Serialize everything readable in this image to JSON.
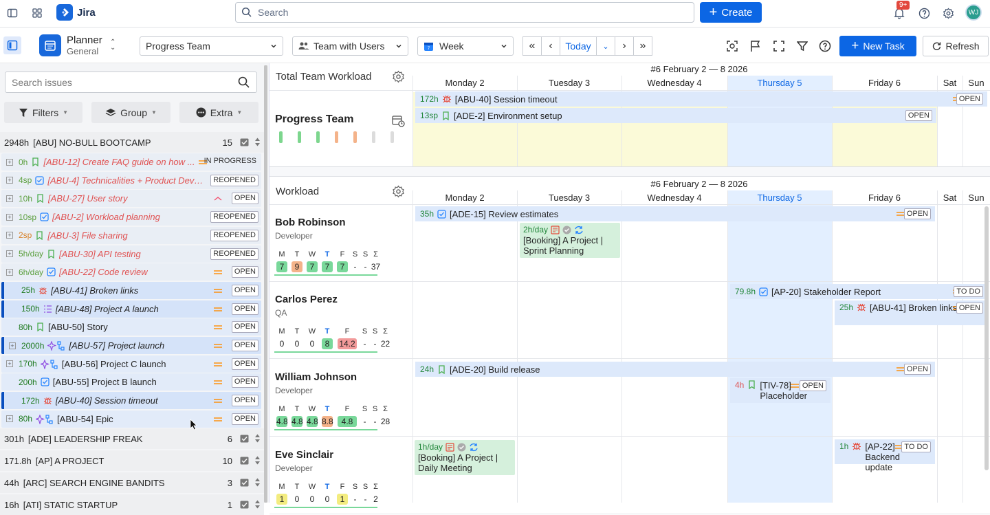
{
  "app": {
    "name": "Jira",
    "search_placeholder": "Search",
    "create_label": "Create",
    "notif_badge": "9+",
    "avatar": "WJ"
  },
  "toolbar": {
    "planner_title": "Planner",
    "planner_sub": "General",
    "team_select": "Progress Team",
    "users_select": "Team with Users",
    "period_select": "Week",
    "today": "Today",
    "new_task": "New Task",
    "refresh": "Refresh"
  },
  "left": {
    "search_placeholder": "Search issues",
    "filters": "Filters",
    "group": "Group",
    "extra": "Extra",
    "groups": [
      {
        "est": "2948h",
        "name": "[ABU] NO-BULL BOOTCAMP",
        "count": "15"
      },
      {
        "est": "301h",
        "name": "[ADE] LEADERSHIP FREAK",
        "count": "6"
      },
      {
        "est": "171.8h",
        "name": "[AP] A PROJECT",
        "count": "10"
      },
      {
        "est": "44h",
        "name": "[ARC] SEARCH ENGINE BANDITS",
        "count": "3"
      },
      {
        "est": "16h",
        "name": "[ATI] STATIC STARTUP",
        "count": "1"
      }
    ],
    "rows": [
      {
        "est": "0h",
        "title": "[ABU-12] Create FAQ guide on how ...",
        "status": "IN PROGRESS",
        "type": "story",
        "color": "red"
      },
      {
        "est": "4sp",
        "title": "[ABU-4] Technicalities + Product Devel...",
        "status": "REOPENED",
        "type": "task",
        "color": "red"
      },
      {
        "est": "10h",
        "title": "[ABU-27] User story",
        "status": "OPEN",
        "type": "story",
        "color": "red"
      },
      {
        "est": "10sp",
        "title": "[ABU-2] Workload planning",
        "status": "REOPENED",
        "type": "task",
        "color": "red"
      },
      {
        "est": "2sp",
        "title": "[ABU-3] File sharing",
        "status": "REOPENED",
        "type": "story",
        "color": "red"
      },
      {
        "est": "5h/day",
        "title": "[ABU-30] API testing",
        "status": "REOPENED",
        "type": "story",
        "color": "red"
      },
      {
        "est": "6h/day",
        "title": "[ABU-22] Code review",
        "status": "OPEN",
        "type": "task",
        "color": "red"
      },
      {
        "est": "25h",
        "title": "[ABU-41] Broken links",
        "status": "OPEN",
        "type": "bug",
        "color": "dark"
      },
      {
        "est": "150h",
        "title": "[ABU-48] Project A launch",
        "status": "OPEN",
        "type": "list",
        "color": "dark"
      },
      {
        "est": "80h",
        "title": "[ABU-50] Story",
        "status": "OPEN",
        "type": "story",
        "color": "plain"
      },
      {
        "est": "2000h",
        "title": "[ABU-57] Project launch",
        "status": "OPEN",
        "type": "epic",
        "color": "dark"
      },
      {
        "est": "170h",
        "title": "[ABU-56] Project C launch",
        "status": "OPEN",
        "type": "epic",
        "color": "plain"
      },
      {
        "est": "200h",
        "title": "[ABU-55] Project B launch",
        "status": "OPEN",
        "type": "task",
        "color": "plain"
      },
      {
        "est": "172h",
        "title": "[ABU-40] Session timeout",
        "status": "OPEN",
        "type": "bug",
        "color": "dark"
      },
      {
        "est": "80h",
        "title": "[ABU-54] Epic",
        "status": "OPEN",
        "type": "epic",
        "color": "plain"
      }
    ]
  },
  "calendar": {
    "week_label": "#6 February 2 — 8 2026",
    "days": [
      "Monday 2",
      "Tuesday 3",
      "Wednesday 4",
      "Thursday 5",
      "Friday 6",
      "Sat",
      "Sun"
    ]
  },
  "team": {
    "section": "Total Team Workload",
    "name": "Progress Team",
    "tasks": [
      {
        "est": "172h",
        "title": "[ABU-40] Session timeout",
        "status": "OPEN"
      },
      {
        "est": "13sp",
        "title": "[ADE-2] Environment setup",
        "status": "OPEN"
      }
    ]
  },
  "workload": {
    "section": "Workload",
    "weekdays": [
      "M",
      "T",
      "W",
      "T",
      "F",
      "S",
      "S",
      "Σ"
    ],
    "people": [
      {
        "name": "Bob Robinson",
        "role": "Developer",
        "vals": [
          "7",
          "9",
          "7",
          "7",
          "7",
          "-",
          "-",
          "37"
        ]
      },
      {
        "name": "Carlos Perez",
        "role": "QA",
        "vals": [
          "0",
          "0",
          "0",
          "8",
          "14.2",
          "-",
          "-",
          "22"
        ]
      },
      {
        "name": "William Johnson",
        "role": "Developer",
        "vals": [
          "4.8",
          "4.8",
          "4.8",
          "8.8",
          "4.8",
          "-",
          "-",
          "28"
        ]
      },
      {
        "name": "Eve Sinclair",
        "role": "Developer",
        "vals": [
          "1",
          "0",
          "0",
          "0",
          "1",
          "-",
          "-",
          "2"
        ]
      }
    ],
    "tasks": {
      "review": {
        "est": "35h",
        "title": "[ADE-15] Review estimates",
        "status": "OPEN"
      },
      "booking1": {
        "rate": "2h/day",
        "text": "[Booking] A Project | Sprint Planning"
      },
      "stake": {
        "est": "79.8h",
        "title": "[AP-20] Stakeholder Report",
        "status": "TO DO"
      },
      "broken": {
        "est": "25h",
        "title": "[ABU-41] Broken links",
        "status": "OPEN"
      },
      "build": {
        "est": "24h",
        "title": "[ADE-20] Build release",
        "status": "OPEN"
      },
      "placeholder": {
        "est": "4h",
        "title": "[TIV-78] Placeholder",
        "status": "OPEN"
      },
      "booking2": {
        "rate": "1h/day",
        "text": "[Booking] A Project | Daily Meeting"
      },
      "backend": {
        "est": "1h",
        "title": "[AP-22] Backend update",
        "status": "TO DO"
      }
    }
  }
}
